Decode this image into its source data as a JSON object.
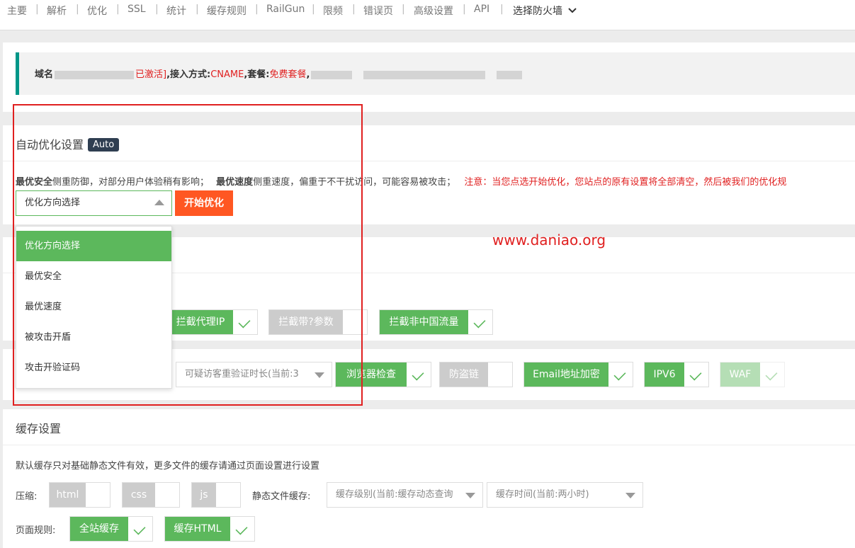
{
  "nav": {
    "items": [
      "主要",
      "解析",
      "优化",
      "SSL",
      "统计",
      "缓存规则",
      "RailGun",
      "限频",
      "错误页",
      "高级设置",
      "API"
    ],
    "separator": "|",
    "firewall_label": "选择防火墙"
  },
  "domain_info": {
    "label": "域名",
    "status": "已激活]",
    "access_label": ",接入方式:",
    "access_value": "CNAME",
    "plan_label": ",套餐:",
    "plan_value": "免费套餐",
    "tail": ","
  },
  "auto_opt": {
    "title": "自动优化设置",
    "badge": "Auto",
    "desc_safe_bold": "最优安全",
    "desc_safe": "侧重防御，对部分用户体验稍有影响；",
    "desc_speed_bold": "最优速度",
    "desc_speed": "侧重速度，偏重于不干扰访问，可能容易被攻击；",
    "warning": "注意：当您点选开始优化，您站点的原有设置将全部清空，然后被我们的优化规",
    "select_value": "优化方向选择",
    "start_button": "开始优化",
    "dropdown_options": [
      "优化方向选择",
      "最优安全",
      "最优速度",
      "被攻击开盾",
      "攻击开验证码"
    ]
  },
  "watermark": "www.daniao.org",
  "security": {
    "row1": [
      {
        "label": "拦截代理IP",
        "on": true
      },
      {
        "label": "拦截带?参数",
        "on": false
      },
      {
        "label": "拦截非中国流量",
        "on": true
      }
    ],
    "verify_select": "可疑访客重验证时长(当前:3",
    "row2": [
      {
        "label": "浏览器检查",
        "on": true
      },
      {
        "label": "防盗链",
        "on": false
      },
      {
        "label": "Email地址加密",
        "on": true
      },
      {
        "label": "IPV6",
        "on": true
      },
      {
        "label": "WAF",
        "on": true,
        "faded": true
      }
    ]
  },
  "cache": {
    "title": "缓存设置",
    "desc": "默认缓存只对基础静态文件有效，更多文件的缓存请通过页面设置进行设置",
    "compress_label": "压缩:",
    "compress": [
      "html",
      "css",
      "js"
    ],
    "static_label": "静态文件缓存:",
    "level_select": "缓存级别(当前:缓存动态查询",
    "time_select": "缓存时间(当前:两小时)",
    "page_rule_label": "页面规则:",
    "page_rules": [
      {
        "label": "全站缓存",
        "on": true
      },
      {
        "label": "缓存HTML",
        "on": true
      }
    ]
  },
  "colors": {
    "green": "#5cb85c",
    "orange": "#ff5722",
    "red": "#e02020",
    "badge": "#2f3e51",
    "teal": "#009688"
  }
}
